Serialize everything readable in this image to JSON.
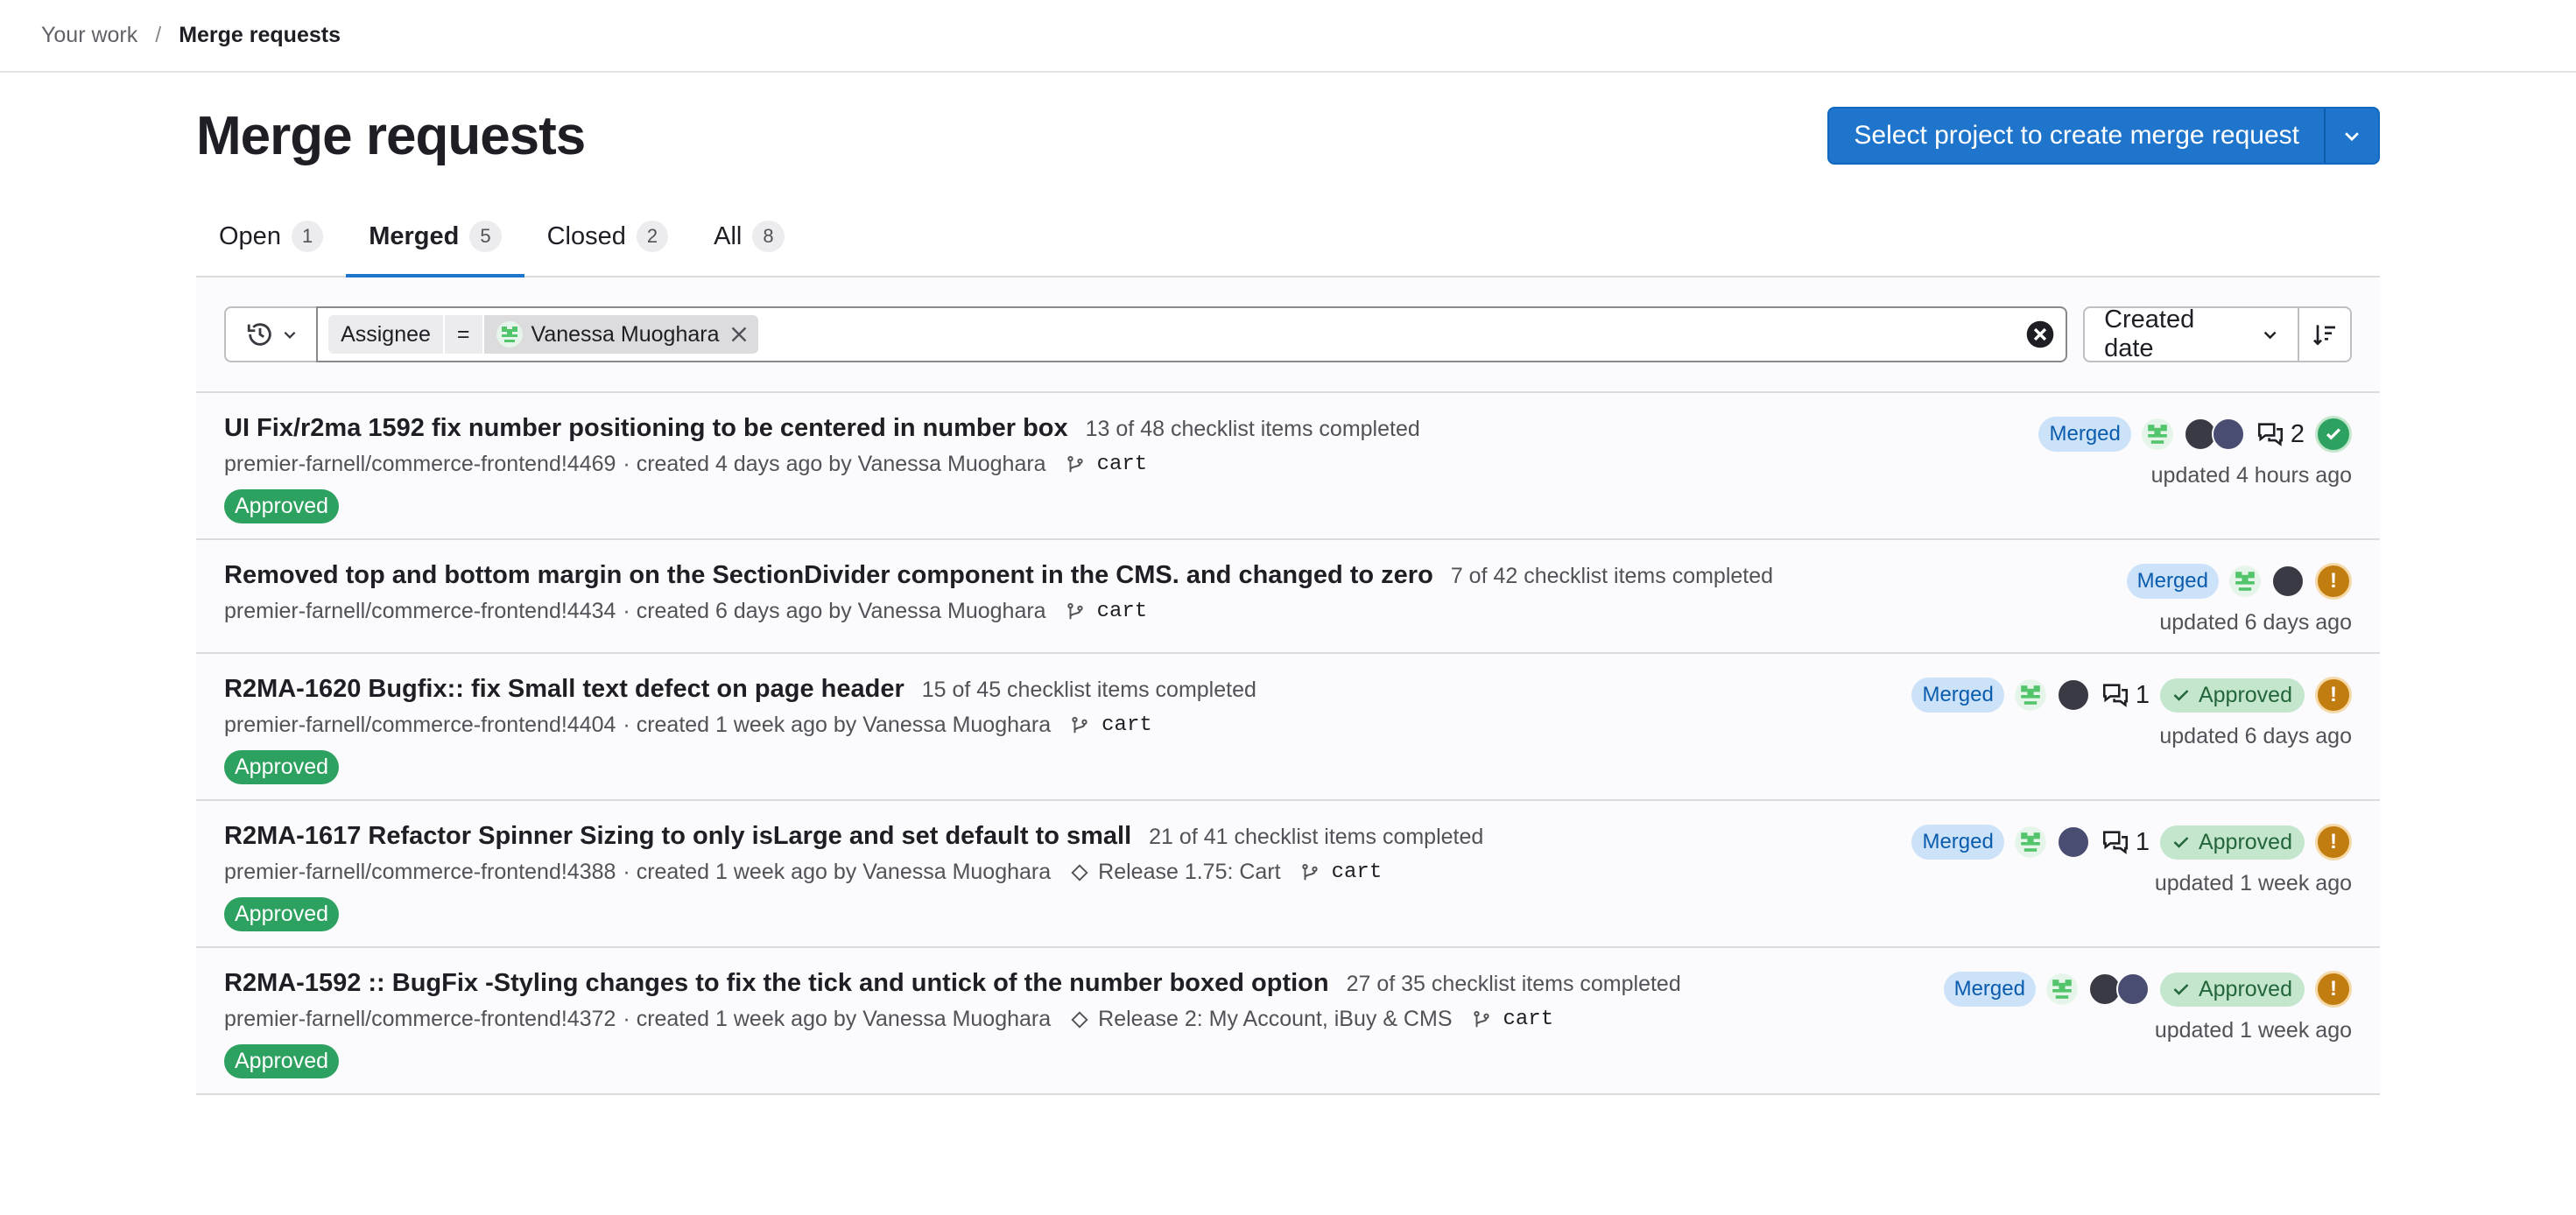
{
  "breadcrumb": {
    "parent": "Your work",
    "separator": "/",
    "current": "Merge requests"
  },
  "header": {
    "title": "Merge requests",
    "create_button_label": "Select project to create merge request"
  },
  "tabs": [
    {
      "label": "Open",
      "count": "1"
    },
    {
      "label": "Merged",
      "count": "5"
    },
    {
      "label": "Closed",
      "count": "2"
    },
    {
      "label": "All",
      "count": "8"
    }
  ],
  "filter": {
    "token_key": "Assignee",
    "token_operator": "=",
    "token_value": "Vanessa Muoghara",
    "sort_label": "Created date"
  },
  "merge_requests": [
    {
      "title": "UI Fix/r2ma 1592 fix number positioning to be centered in number box",
      "checklist": "13 of 48 checklist items completed",
      "reference": "premier-farnell/commerce-frontend!4469",
      "created": "· created 4 days ago by Vanessa Muoghara",
      "milestone": "",
      "branch": "cart",
      "approved_pill": "Approved",
      "status": "Merged",
      "comments": "2",
      "approved_badge": "",
      "pipeline": "success",
      "updated": "updated 4 hours ago"
    },
    {
      "title": "Removed top and bottom margin on the SectionDivider component in the CMS. and changed to zero",
      "checklist": "7 of 42 checklist items completed",
      "reference": "premier-farnell/commerce-frontend!4434",
      "created": "· created 6 days ago by Vanessa Muoghara",
      "milestone": "",
      "branch": "cart",
      "approved_pill": "",
      "status": "Merged",
      "comments": "",
      "approved_badge": "",
      "pipeline": "warning",
      "updated": "updated 6 days ago"
    },
    {
      "title": "R2MA-1620 Bugfix:: fix Small text defect on page header",
      "checklist": "15 of 45 checklist items completed",
      "reference": "premier-farnell/commerce-frontend!4404",
      "created": "· created 1 week ago by Vanessa Muoghara",
      "milestone": "",
      "branch": "cart",
      "approved_pill": "Approved",
      "status": "Merged",
      "comments": "1",
      "approved_badge": "Approved",
      "pipeline": "warning",
      "updated": "updated 6 days ago"
    },
    {
      "title": "R2MA-1617 Refactor Spinner Sizing to only isLarge and set default to small",
      "checklist": "21 of 41 checklist items completed",
      "reference": "premier-farnell/commerce-frontend!4388",
      "created": "· created 1 week ago by Vanessa Muoghara",
      "milestone": "Release 1.75: Cart",
      "branch": "cart",
      "approved_pill": "Approved",
      "status": "Merged",
      "comments": "1",
      "approved_badge": "Approved",
      "pipeline": "warning",
      "updated": "updated 1 week ago"
    },
    {
      "title": "R2MA-1592 :: BugFix -Styling changes to fix the tick and untick of the number boxed option",
      "checklist": "27 of 35 checklist items completed",
      "reference": "premier-farnell/commerce-frontend!4372",
      "created": "· created 1 week ago by Vanessa Muoghara",
      "milestone": "Release 2: My Account, iBuy & CMS",
      "branch": "cart",
      "approved_pill": "Approved",
      "status": "Merged",
      "comments": "",
      "approved_badge": "Approved",
      "pipeline": "warning",
      "updated": "updated 1 week ago"
    }
  ],
  "colors": {
    "brand_blue": "#1f75cb",
    "approved_green": "#2da160",
    "merged_badge_bg": "#cbe2f9",
    "warning_orange": "#c17d10"
  }
}
